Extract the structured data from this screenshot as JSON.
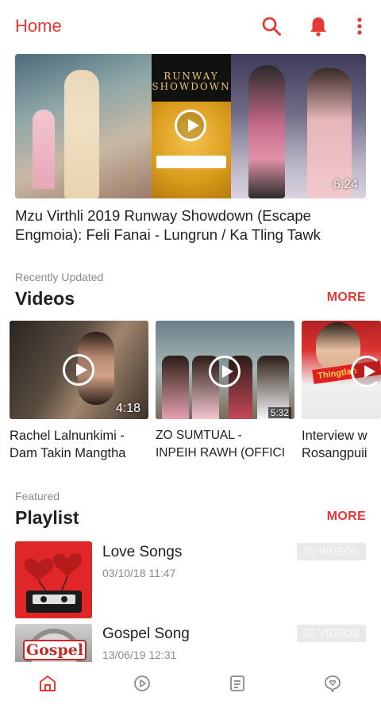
{
  "header": {
    "title": "Home",
    "icons": [
      "search-icon",
      "bell-icon",
      "more-vert-icon"
    ]
  },
  "accent_color": "#e53935",
  "hero": {
    "title": "Mzu Virthli 2019 Runway Showdown (Escape Engmoia): Feli Fanai - Lungrun / Ka Tling Tawk",
    "duration": "6:24",
    "poster_text": "RUNWAY SHOWDOWN"
  },
  "videos_section": {
    "subtitle": "Recently Updated",
    "title": "Videos",
    "more_label": "MORE",
    "items": [
      {
        "line1": "Rachel Lalnunkimi -",
        "line2": "Dam Takin Mangtha",
        "duration": "4:18"
      },
      {
        "line1": "ZO SUMTUAL -",
        "line2": "INPEIH RAWH (OFFICI",
        "duration": "5:32"
      },
      {
        "line1": "Interview w",
        "line2": "Rosangpuii",
        "thumb_text": "Thingtlan"
      }
    ]
  },
  "playlist_section": {
    "subtitle": "Featured",
    "title": "Playlist",
    "more_label": "MORE",
    "items": [
      {
        "title": "Love Songs",
        "date": "03/10/18 11:47",
        "count": "70 VIDEOS"
      },
      {
        "title": "Gospel Song",
        "date": "13/06/19 12:31",
        "count": "25 VIDEOS",
        "thumb_text": "Gospel"
      }
    ]
  },
  "bottom_nav": {
    "items": [
      "home-icon",
      "play-circle-icon",
      "list-icon",
      "heart-chat-icon"
    ],
    "active_index": 0
  }
}
